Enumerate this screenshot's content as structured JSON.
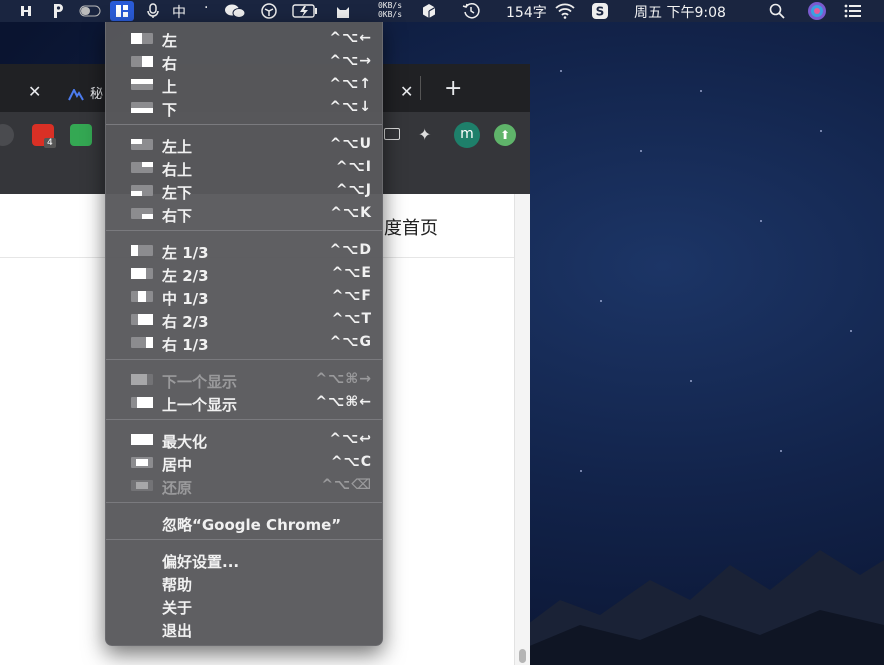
{
  "menubar": {
    "net_up": "0KB/s",
    "net_down": "0KB/s",
    "input_method": "中",
    "word_count": "154字",
    "datetime": "周五 下午9:08",
    "active_icon": "window-layout-icon"
  },
  "chrome": {
    "tab_partial_label": "秘",
    "page_link_text": "度首页",
    "new_tab": "+",
    "extension_badge": "4",
    "profile_initial": "m"
  },
  "menu": {
    "groups": [
      [
        {
          "label": "左",
          "shortcut": "^⌥←",
          "glyph": "left-half"
        },
        {
          "label": "右",
          "shortcut": "^⌥→",
          "glyph": "right-half"
        },
        {
          "label": "上",
          "shortcut": "^⌥↑",
          "glyph": "top-half"
        },
        {
          "label": "下",
          "shortcut": "^⌥↓",
          "glyph": "bottom-half"
        }
      ],
      [
        {
          "label": "左上",
          "shortcut": "^⌥U",
          "glyph": "top-left"
        },
        {
          "label": "右上",
          "shortcut": "^⌥I",
          "glyph": "top-right"
        },
        {
          "label": "左下",
          "shortcut": "^⌥J",
          "glyph": "bottom-left"
        },
        {
          "label": "右下",
          "shortcut": "^⌥K",
          "glyph": "bottom-right"
        }
      ],
      [
        {
          "label": "左 1/3",
          "shortcut": "^⌥D",
          "glyph": "left-third"
        },
        {
          "label": "左 2/3",
          "shortcut": "^⌥E",
          "glyph": "left-two-thirds"
        },
        {
          "label": "中 1/3",
          "shortcut": "^⌥F",
          "glyph": "center-third"
        },
        {
          "label": "右 2/3",
          "shortcut": "^⌥T",
          "glyph": "right-two-thirds"
        },
        {
          "label": "右 1/3",
          "shortcut": "^⌥G",
          "glyph": "right-third"
        }
      ],
      [
        {
          "label": "下一个显示",
          "shortcut": "^⌥⌘→",
          "glyph": "next-display",
          "disabled": true
        },
        {
          "label": "上一个显示",
          "shortcut": "^⌥⌘←",
          "glyph": "previous-display"
        }
      ],
      [
        {
          "label": "最大化",
          "shortcut": "^⌥↩",
          "glyph": "maximize"
        },
        {
          "label": "居中",
          "shortcut": "^⌥C",
          "glyph": "center"
        },
        {
          "label": "还原",
          "shortcut": "^⌥⌫",
          "glyph": "restore",
          "disabled": true
        }
      ],
      [
        {
          "label": "忽略“Google Chrome”",
          "shortcut": ""
        }
      ],
      [
        {
          "label": "偏好设置...",
          "shortcut": ""
        },
        {
          "label": "帮助",
          "shortcut": ""
        },
        {
          "label": "关于",
          "shortcut": ""
        },
        {
          "label": "退出",
          "shortcut": ""
        }
      ]
    ]
  }
}
